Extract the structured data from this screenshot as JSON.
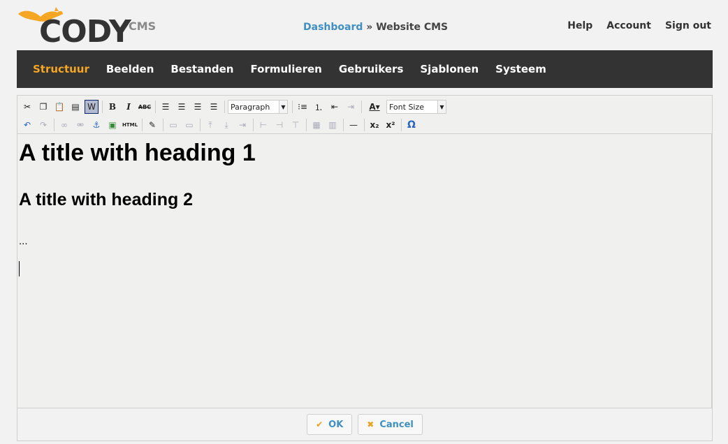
{
  "brand": {
    "name": "CODY",
    "suffix": "CMS",
    "squirrel_color": "#f5a623"
  },
  "breadcrumb": {
    "root": "Dashboard",
    "separator": "»",
    "current": "Website CMS"
  },
  "toplinks": [
    "Help",
    "Account",
    "Sign out"
  ],
  "nav": {
    "items": [
      "Structuur",
      "Beelden",
      "Bestanden",
      "Formulieren",
      "Gebruikers",
      "Sjablonen",
      "Systeem"
    ],
    "active": "Structuur",
    "accent": "#f5a623",
    "background": "#333333"
  },
  "toolbar": {
    "format_select": "Paragraph",
    "fontsize_select": "Font Size",
    "bold": "B",
    "italic": "I",
    "strike": "ABC",
    "html": "HTML",
    "subscript": "x₂",
    "superscript": "x²",
    "charmap": "Ω"
  },
  "editor": {
    "h1": "A title with heading 1",
    "h2": "A title with heading 2",
    "paragraph": "..."
  },
  "footer": {
    "ok": "OK",
    "cancel": "Cancel",
    "link_color": "#3f8fc0"
  }
}
